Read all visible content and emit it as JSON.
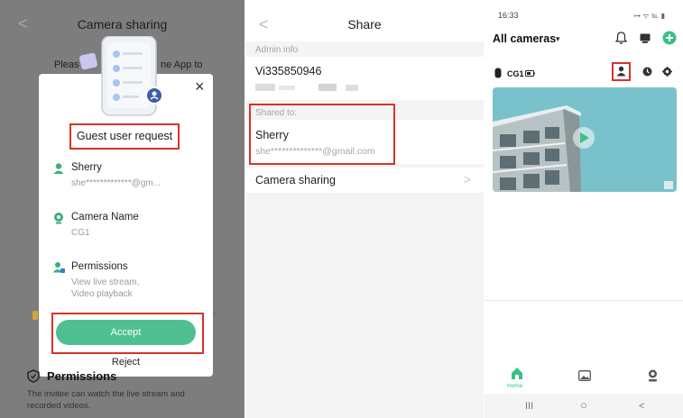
{
  "panel1": {
    "back_glyph": "<",
    "title": "Camera sharing",
    "bg_text_left": "Pleas",
    "bg_text_right": "ne App to",
    "close_glyph": "×",
    "request_title": "Guest user request",
    "guest": {
      "label": "Sherry",
      "value": "she*************@gm..."
    },
    "camera": {
      "label": "Camera Name",
      "value": "CG1"
    },
    "permissions": {
      "label": "Permissions",
      "lines": [
        "View live stream,",
        "Video playback"
      ]
    },
    "accept_label": "Accept",
    "reject_label": "Reject",
    "section_title": "Permissions",
    "section_desc": "The invitee can watch the live stream and recorded videos.",
    "side_mark": "l",
    "colors": {
      "accent": "#4fbf92",
      "highlight": "#d6332a",
      "overlay": "#7d7d7d"
    }
  },
  "panel2": {
    "back_glyph": "<",
    "title": "Share",
    "admin_label": "Admin info",
    "admin_id": "Vi335850946",
    "shared_label": "Shared to:",
    "shared_name": "Sherry",
    "shared_email": "she**************@gmail.com",
    "camera_sharing_label": "Camera sharing",
    "chevron_glyph": ">"
  },
  "panel3": {
    "time": "16:33",
    "status_right": "⊶ ᯤ ℡ ▮",
    "all_cameras": "All cameras",
    "caret_glyph": "▾",
    "camera_name": "CG1",
    "home_label": "Home",
    "sys_recent": "III",
    "sys_home": "○",
    "sys_back": "<",
    "icons": [
      "bell-icon",
      "message-icon",
      "add-icon",
      "camera-device-icon",
      "battery-icon",
      "user-share-icon",
      "clock-icon",
      "settings-icon",
      "play-icon",
      "home-icon",
      "gallery-icon",
      "profile-icon"
    ],
    "colors": {
      "accent": "#3cbf86"
    }
  }
}
